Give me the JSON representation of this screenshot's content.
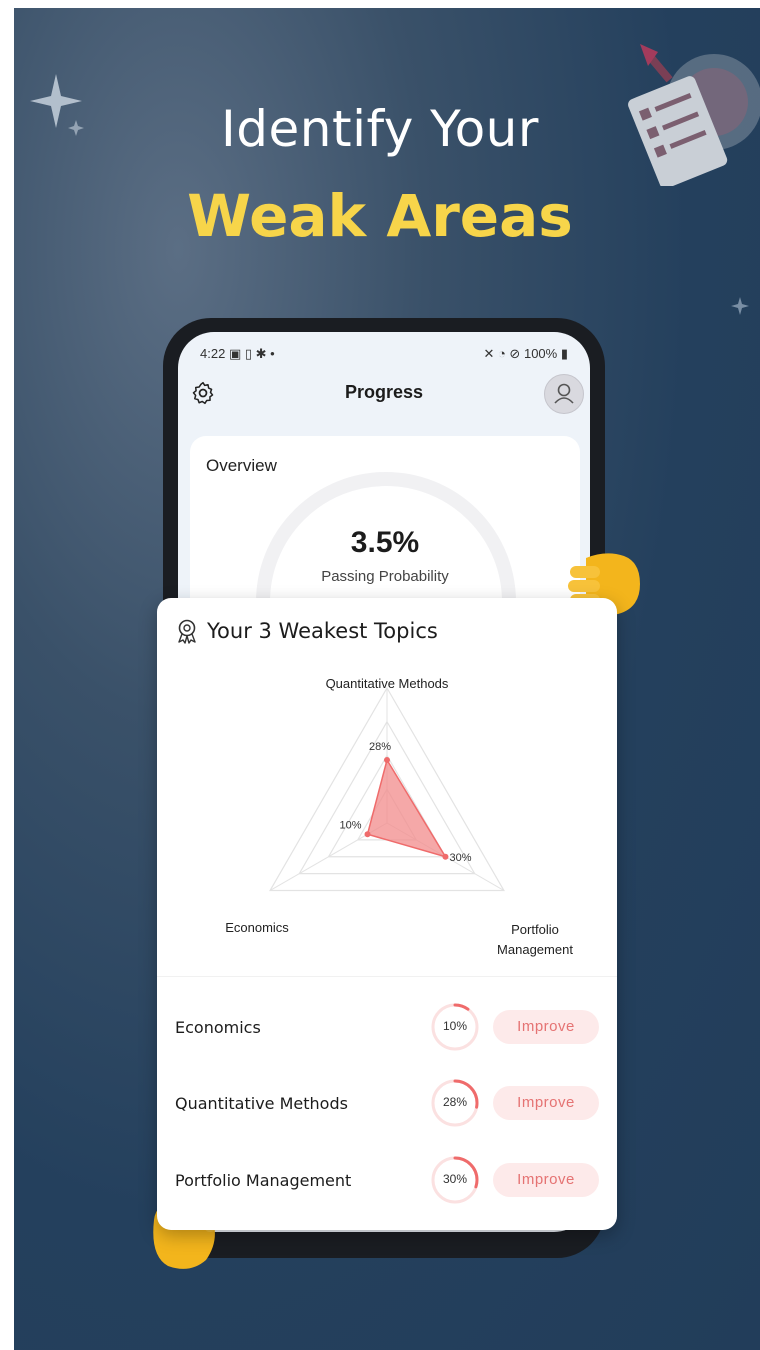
{
  "headline": {
    "line1": "Identify Your",
    "line2": "Weak Areas"
  },
  "colors": {
    "background": "#24405d",
    "accent_yellow": "#f7d54a",
    "radar_fill": "#f28b8b",
    "improve_text": "#e57373",
    "improve_bg": "#fdeaea"
  },
  "status_bar": {
    "time": "4:22",
    "left_icons": "▣ ▯ ✱ •",
    "right_icons": "✕ ◔ ⊘",
    "battery": "100%"
  },
  "app_bar": {
    "title": "Progress",
    "left_icon": "gear-icon",
    "right_icon": "user-avatar-icon"
  },
  "overview": {
    "title": "Overview",
    "probability_value": "3.5%",
    "probability_label": "Passing Probability"
  },
  "weakest": {
    "title": "Your 3 Weakest Topics",
    "icon": "award-badge-icon",
    "radar_axes": [
      "Quantitative Methods",
      "Economics",
      "Portfolio Management"
    ],
    "rows": [
      {
        "name": "Economics",
        "percent": "10%",
        "value": 10,
        "button": "Improve"
      },
      {
        "name": "Quantitative Methods",
        "percent": "28%",
        "value": 28,
        "button": "Improve"
      },
      {
        "name": "Portfolio Management",
        "percent": "30%",
        "value": 30,
        "button": "Improve"
      }
    ]
  },
  "chart_data": {
    "type": "radar",
    "categories": [
      "Quantitative Methods",
      "Portfolio Management",
      "Economics"
    ],
    "values": [
      28,
      30,
      10
    ],
    "value_labels": [
      "28%",
      "30%",
      "10%"
    ]
  }
}
